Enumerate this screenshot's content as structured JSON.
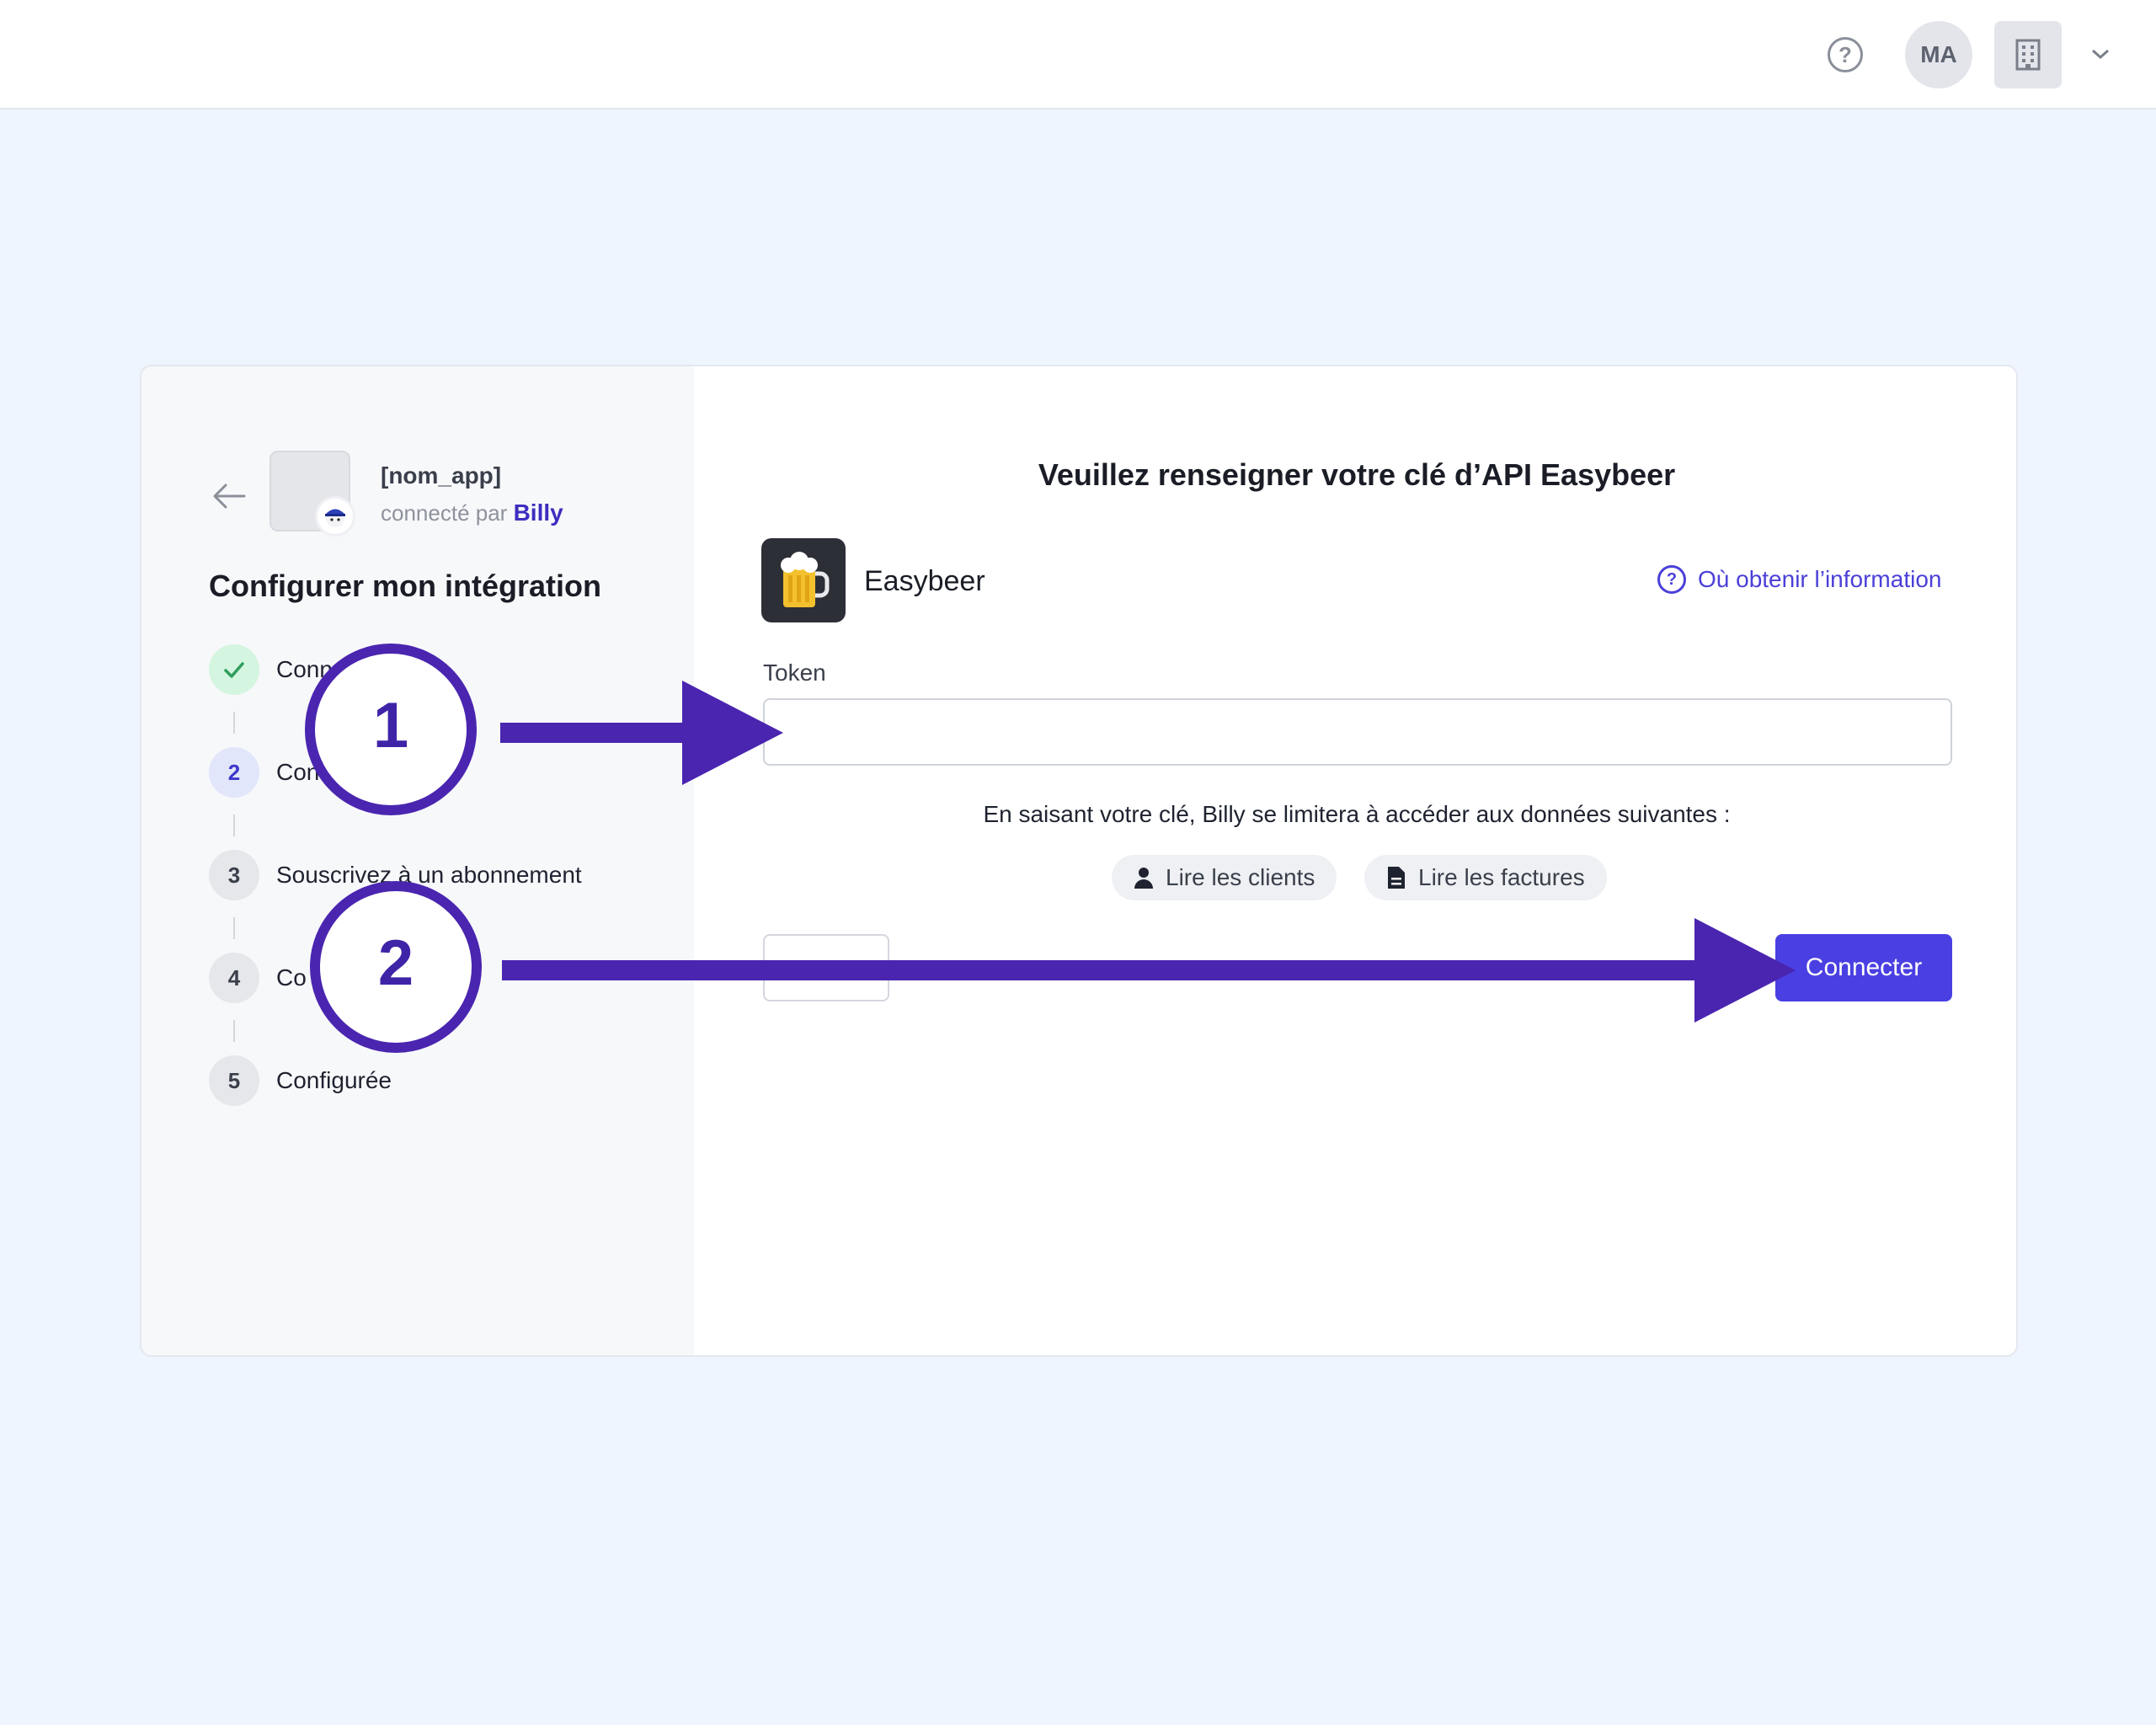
{
  "header": {
    "help_icon": "question-circle-icon",
    "avatar_initials": "MA",
    "org_icon": "building-icon",
    "menu_icon": "chevron-down-icon"
  },
  "sidebar": {
    "back_icon": "arrow-left-icon",
    "app_name": "[nom_app]",
    "connected_by_prefix": "connecté par",
    "connected_by_brand": "Billy",
    "title": "Configurer mon intégration",
    "steps": [
      {
        "number": "",
        "status": "done",
        "label": "Conn            _app]"
      },
      {
        "number": "2",
        "status": "active",
        "label": "Con                eer"
      },
      {
        "number": "3",
        "status": "todo",
        "label": "Souscrivez à un abonnement"
      },
      {
        "number": "4",
        "status": "todo",
        "label": "Co"
      },
      {
        "number": "5",
        "status": "todo",
        "label": "Configurée"
      }
    ]
  },
  "main": {
    "title": "Veuillez renseigner votre clé d’API Easybeer",
    "integration_name": "Easybeer",
    "integration_icon": "beer-mug-icon",
    "help_link": "Où obtenir l’information",
    "token_label": "Token",
    "token_value": "",
    "permission_text": "En saisant votre clé, Billy se limitera à accéder aux données suivantes :",
    "permissions": [
      {
        "icon": "person-icon",
        "label": "Lire les clients"
      },
      {
        "icon": "document-icon",
        "label": "Lire les factures"
      }
    ],
    "connect_label": "Connecter"
  },
  "annotations": {
    "marker_1": "1",
    "marker_2": "2",
    "color": "#4a25b0"
  },
  "colors": {
    "accent": "#4a3fe2",
    "brand": "#3d2dbf",
    "page_bg": "#eef5fe",
    "success": "#2e9e5b"
  }
}
